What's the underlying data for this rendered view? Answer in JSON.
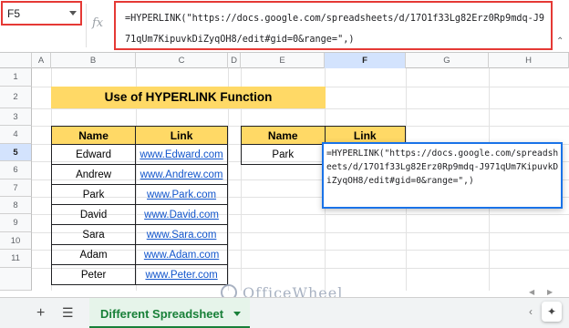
{
  "name_box": {
    "value": "F5"
  },
  "formula_bar": {
    "fx_label": "fx",
    "formula": "=HYPERLINK(\"https://docs.google.com/spreadsheets/d/17O1f33Lg82Erz0Rp9mdq-J971qUm7KipuvkDiZyqOH8/edit#gid=0&range=\",)"
  },
  "columns": [
    "A",
    "B",
    "C",
    "D",
    "E",
    "F",
    "G",
    "H"
  ],
  "rows": [
    "1",
    "2",
    "3",
    "4",
    "5",
    "6",
    "7",
    "8",
    "9",
    "10",
    "11"
  ],
  "title": "Use of HYPERLINK Function",
  "left_table": {
    "headers": [
      "Name",
      "Link"
    ],
    "rows": [
      {
        "name": "Edward",
        "link": "www.Edward.com"
      },
      {
        "name": "Andrew",
        "link": "www.Andrew.com"
      },
      {
        "name": "Park",
        "link": "www.Park.com"
      },
      {
        "name": "David",
        "link": "www.David.com"
      },
      {
        "name": "Sara",
        "link": "www.Sara.com"
      },
      {
        "name": "Adam",
        "link": "www.Adam.com"
      },
      {
        "name": "Peter",
        "link": "www.Peter.com"
      }
    ]
  },
  "right_table": {
    "headers": [
      "Name",
      "Link"
    ],
    "rows": [
      {
        "name": "Park"
      }
    ]
  },
  "cell_editor": {
    "formula": "=HYPERLINK(\"https://docs.google.com/spreadsheets/d/17O1f33Lg82Erz0Rp9mdq-J971qUm7KipuvkDiZyqOH8/edit#gid=0&range=\",)"
  },
  "sheet_tab": {
    "label": "Different Spreadsheet"
  },
  "watermark": "OfficeWheel",
  "colors": {
    "header_fill": "#ffd966",
    "link": "#1155cc",
    "active_tab": "#188038",
    "highlight_border": "#e53935",
    "editor_border": "#1a73e8"
  }
}
